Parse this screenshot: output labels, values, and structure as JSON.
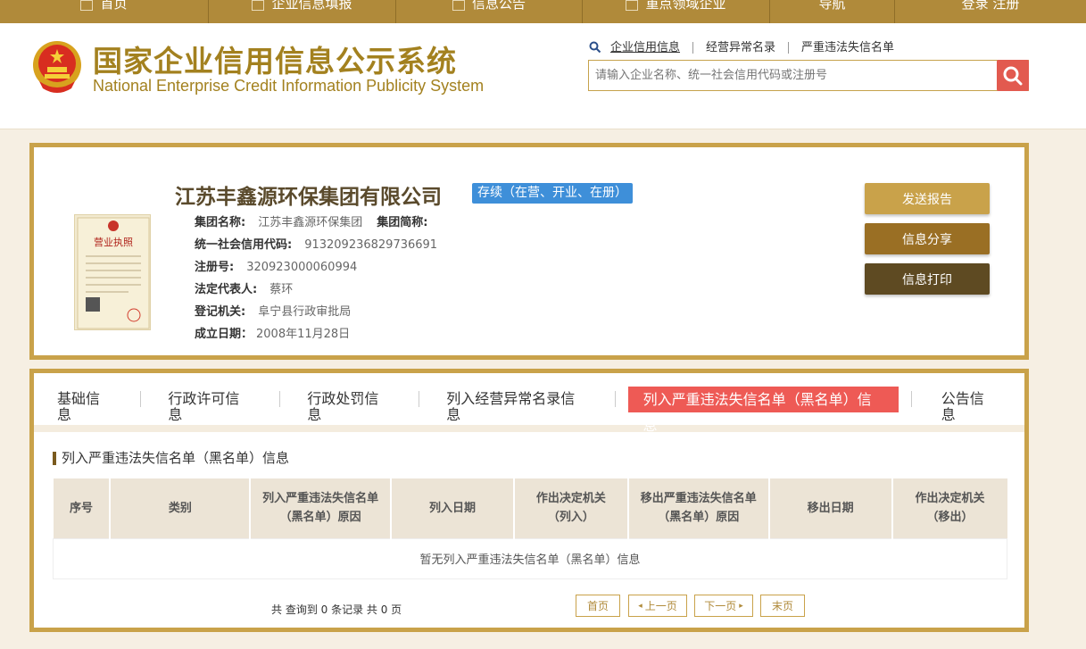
{
  "topnav": {
    "items": [
      "首页",
      "企业信息填报",
      "信息公告",
      "重点领域企业",
      "导航",
      "登录  注册"
    ]
  },
  "header": {
    "title_cn": "国家企业信用信息公示系统",
    "title_en": "National Enterprise Credit Information Publicity System",
    "search_links": [
      "企业信用信息",
      "经营异常名录",
      "严重违法失信名单"
    ],
    "search_placeholder": "请输入企业名称、统一社会信用代码或注册号"
  },
  "company": {
    "name": "江苏丰鑫源环保集团有限公司",
    "status": "存续（在营、开业、在册）",
    "group_name_label": "集团名称:",
    "group_name": "江苏丰鑫源环保集团",
    "group_abbr_label": "集团简称:",
    "credit_code_label": "统一社会信用代码:",
    "credit_code": "913209236829736691",
    "reg_no_label": "注册号:",
    "reg_no": "320923000060994",
    "legal_rep_label": "法定代表人:",
    "legal_rep": "蔡环",
    "reg_authority_label": "登记机关:",
    "reg_authority": "阜宁县行政审批局",
    "est_date_label": "成立日期：",
    "est_date": "2008年11月28日",
    "license_title": "营业执照"
  },
  "actions": {
    "send_report": "发送报告",
    "share": "信息分享",
    "print": "信息打印"
  },
  "tabs": [
    "基础信息",
    "行政许可信息",
    "行政处罚信息",
    "列入经营异常名录信息",
    "列入严重违法失信名单（黑名单）信息",
    "公告信息"
  ],
  "section": {
    "title": "列入严重违法失信名单（黑名单）信息",
    "columns": [
      "序号",
      "类别",
      "列入严重违法失信名单（黑名单）原因",
      "列入日期",
      "作出决定机关（列入）",
      "移出严重违法失信名单（黑名单）原因",
      "移出日期",
      "作出决定机关（移出）"
    ],
    "empty_text": "暂无列入严重违法失信名单（黑名单）信息"
  },
  "pager": {
    "info": "共 查询到 0 条记录 共 0 页",
    "first": "首页",
    "prev": "上一页",
    "next": "下一页",
    "last": "末页"
  },
  "colors": {
    "gold": "#c9a24a",
    "brown_dark": "#5e4a22",
    "brown": "#9a6f24",
    "gold_btn": "#c9a24a",
    "red": "#ee5a55",
    "blue": "#3e8fd9"
  }
}
